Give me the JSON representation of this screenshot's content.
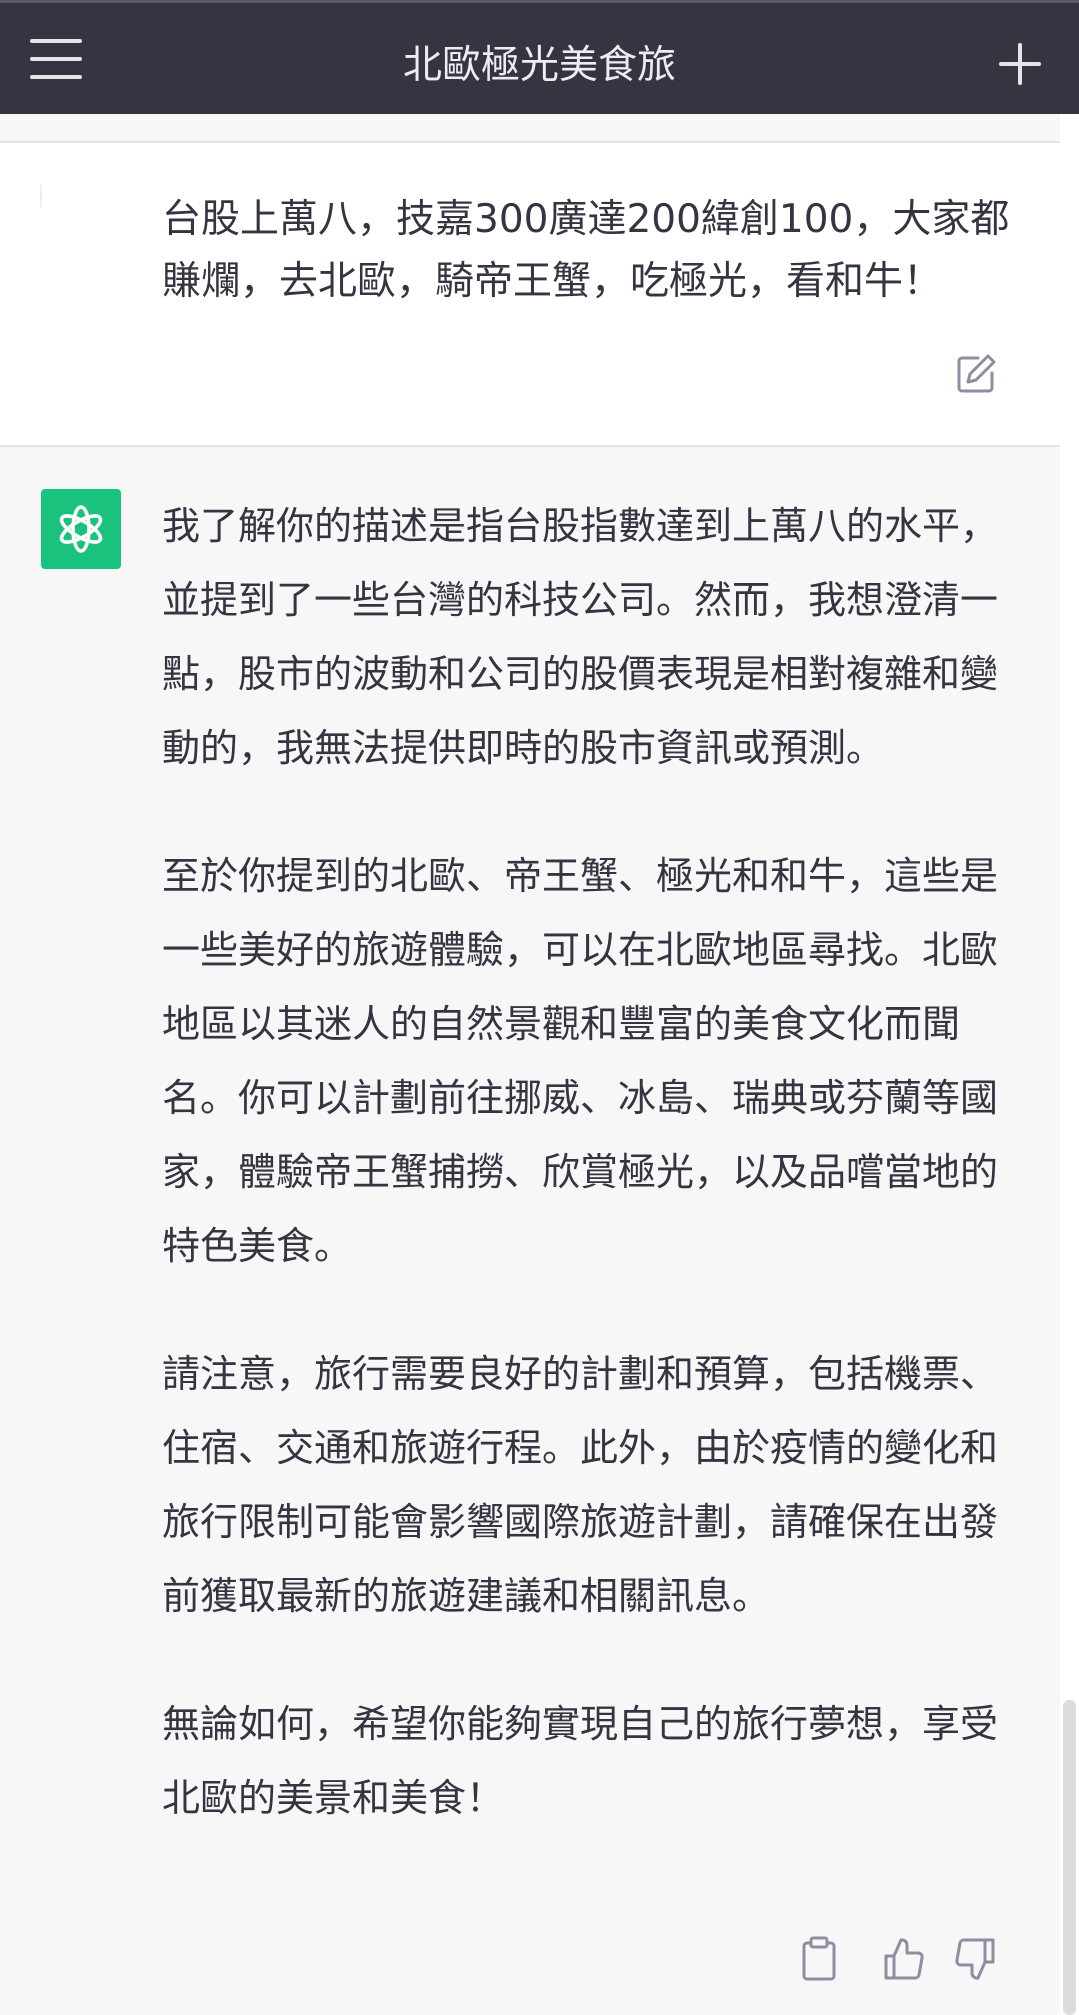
{
  "header": {
    "title": "北歐極光美食旅",
    "menu_icon": "hamburger-menu-icon",
    "new_chat_icon": "plus-icon"
  },
  "user_message": {
    "text": "台股上萬八，技嘉300廣達200緯創100，大家都賺爛，去北歐，騎帝王蟹，吃極光，看和牛！",
    "edit_icon": "edit-icon"
  },
  "assistant_message": {
    "avatar_icon": "openai-logo-icon",
    "avatar_color": "#19c37d",
    "paragraphs": [
      "我了解你的描述是指台股指數達到上萬八的水平，並提到了一些台灣的科技公司。然而，我想澄清一點，股市的波動和公司的股價表現是相對複雜和變動的，我無法提供即時的股市資訊或預測。",
      "至於你提到的北歐、帝王蟹、極光和和牛，這些是一些美好的旅遊體驗，可以在北歐地區尋找。北歐地區以其迷人的自然景觀和豐富的美食文化而聞名。你可以計劃前往挪威、冰島、瑞典或芬蘭等國家，體驗帝王蟹捕撈、欣賞極光，以及品嚐當地的特色美食。",
      "請注意，旅行需要良好的計劃和預算，包括機票、住宿、交通和旅遊行程。此外，由於疫情的變化和旅行限制可能會影響國際旅遊計劃，請確保在出發前獲取最新的旅遊建議和相關訊息。",
      "無論如何，希望你能夠實現自己的旅行夢想，享受北歐的美景和美食！"
    ],
    "actions": [
      "copy-icon",
      "thumbs-up-icon",
      "thumbs-down-icon"
    ]
  },
  "colors": {
    "header_bg": "#343541",
    "header_text": "#ececf1",
    "assistant_bg": "#f7f7f8",
    "user_bg": "#ffffff",
    "text": "#343541",
    "icon_gray": "#8e8ea0"
  }
}
